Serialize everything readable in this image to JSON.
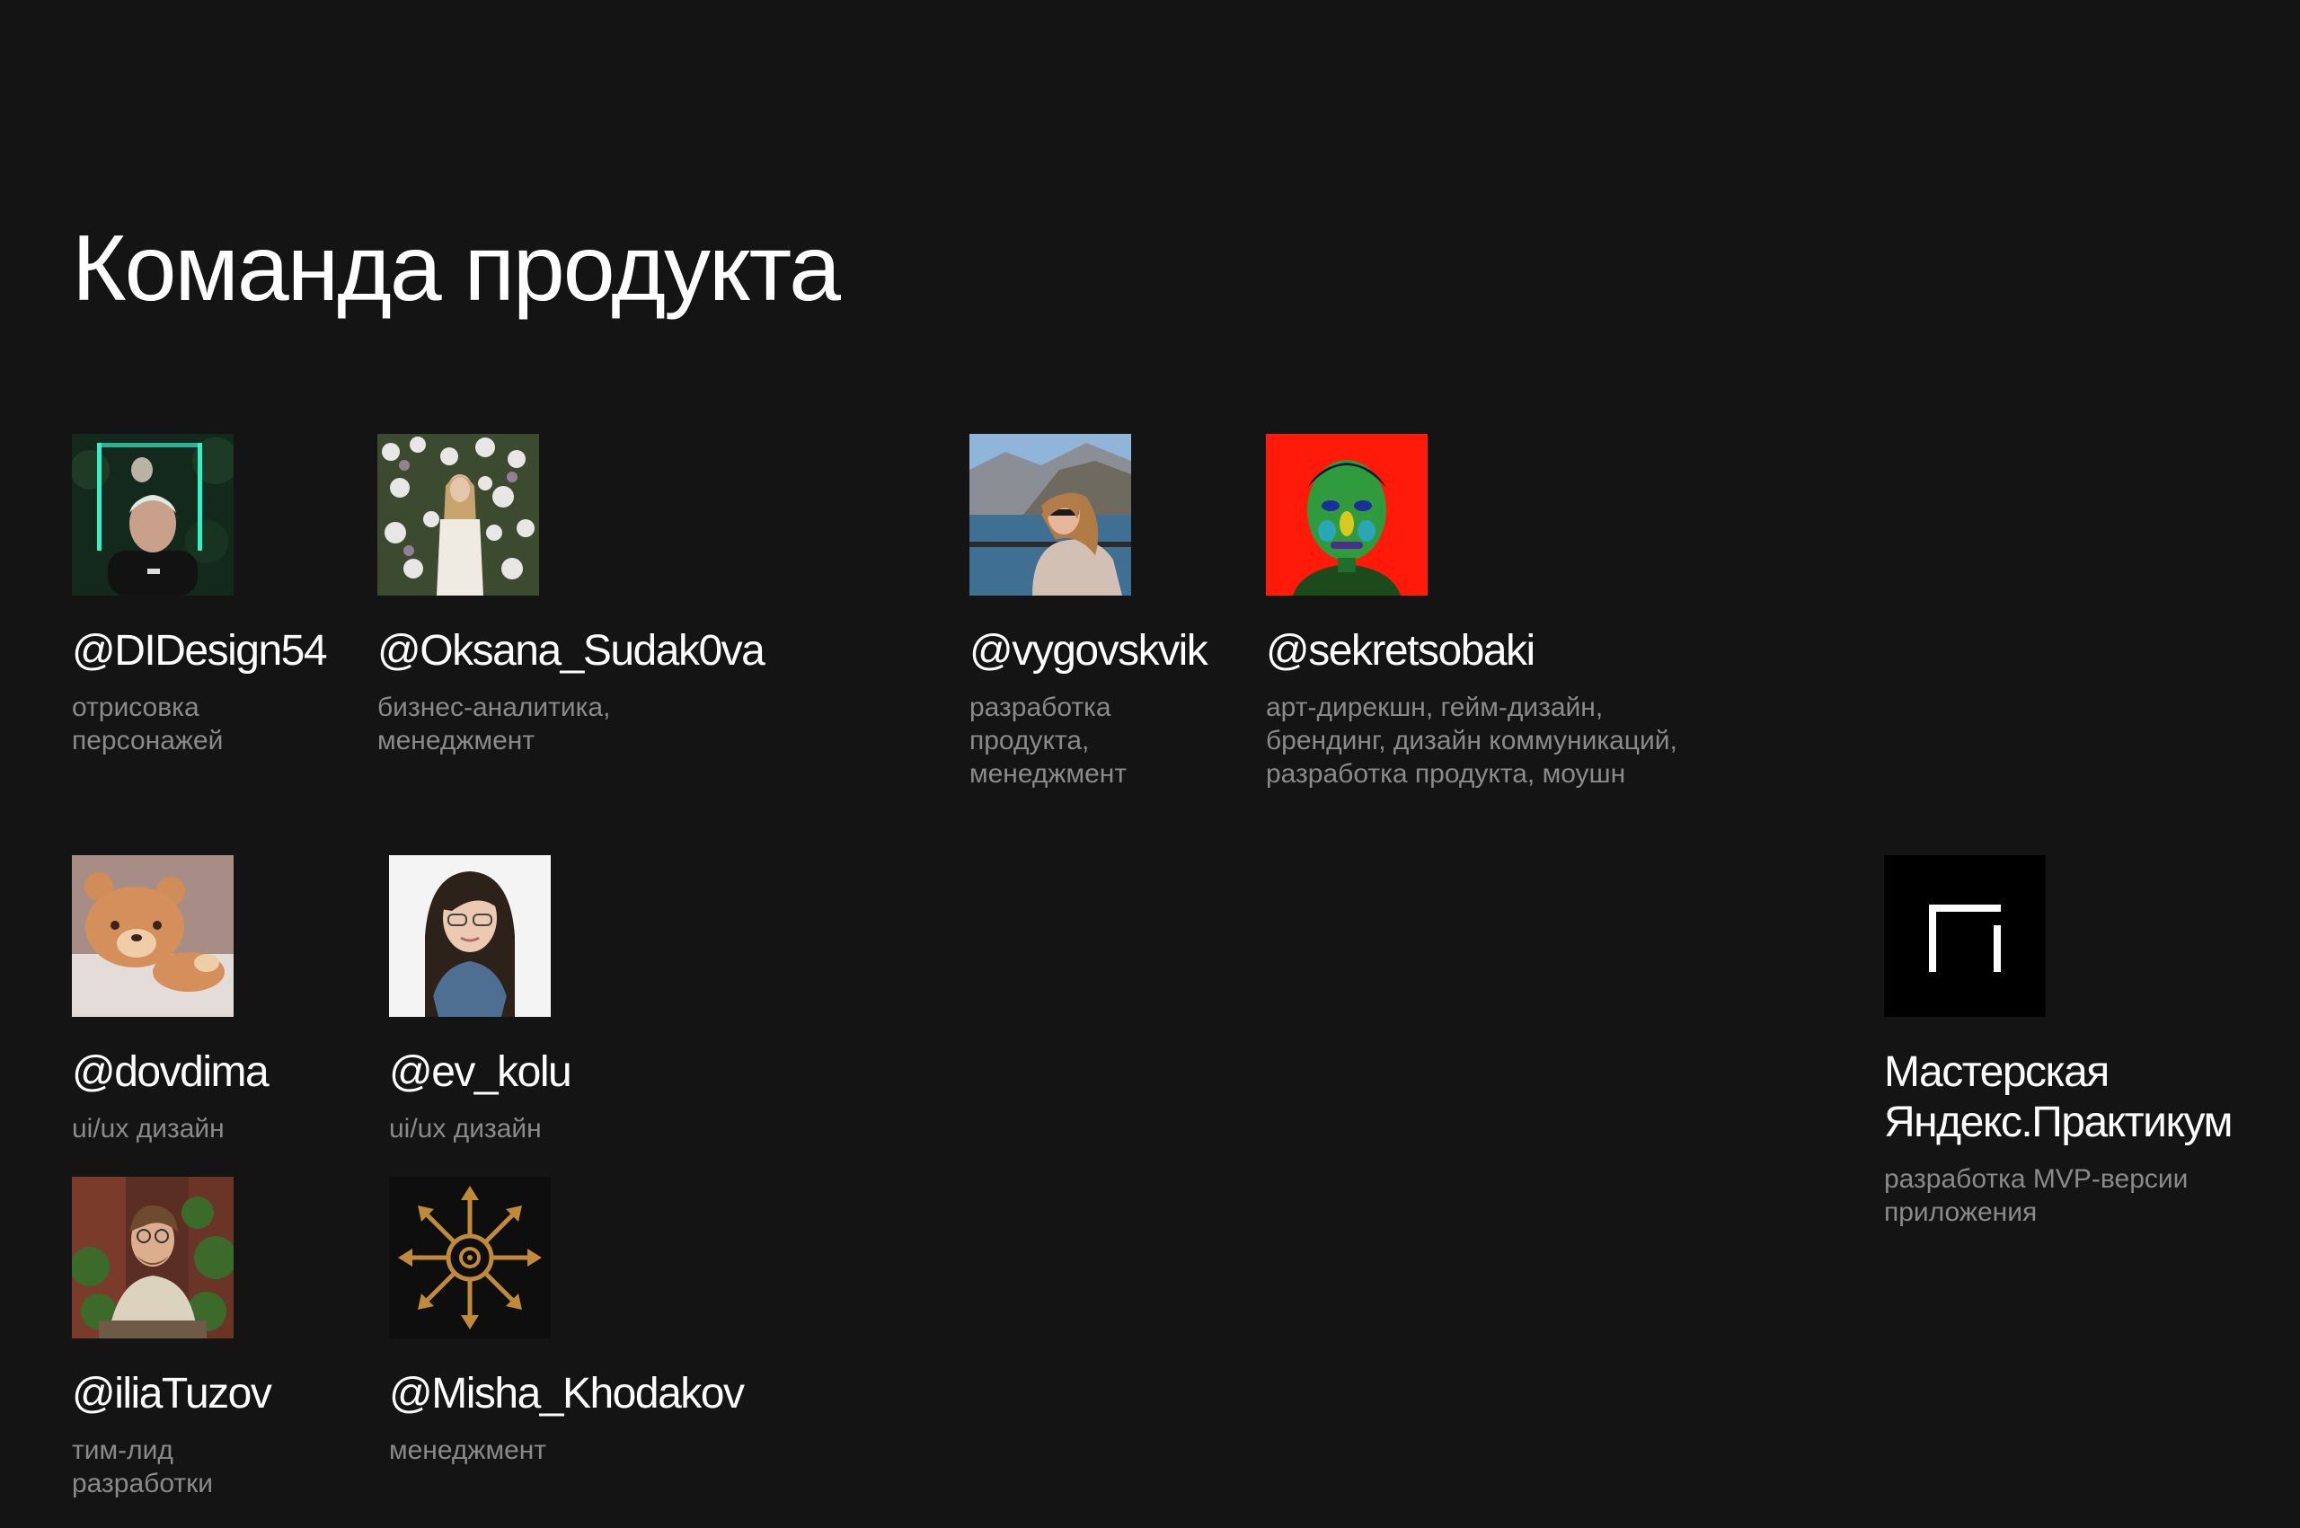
{
  "page": {
    "title": "Команда продукта"
  },
  "members": [
    {
      "handle": "@DIDesign54",
      "role": "отрисовка\nперсонажей",
      "avatar": "photo-neon-portrait"
    },
    {
      "handle": "@Oksana_Sudak0va",
      "role": "бизнес-аналитика,\nменеджмент",
      "avatar": "photo-flowers-portrait"
    },
    {
      "handle": "@vygovskvik",
      "role": "разработка\nпродукта,\nменеджмент",
      "avatar": "photo-lake-portrait"
    },
    {
      "handle": "@sekretsobaki",
      "role": "арт-дирекшн, гейм-дизайн,\nбрендинг, дизайн коммуникаций,\nразработка продукта, моушн",
      "avatar": "photo-thermal-portrait"
    },
    {
      "handle": "@dovdima",
      "role": "ui/ux дизайн",
      "avatar": "photo-teddy-bear"
    },
    {
      "handle": "@ev_kolu",
      "role": "ui/ux дизайн",
      "avatar": "photo-studio-portrait"
    },
    {
      "handle": "@iliaTuzov",
      "role": "тим-лид\nразработки",
      "avatar": "photo-garden-portrait"
    },
    {
      "handle": "@Misha_Khodakov",
      "role": "менеджмент",
      "avatar": "chaos-star-icon"
    }
  ],
  "studio": {
    "name": "Мастерская\nЯндекс.Практикум",
    "role": "разработка MVP-версии\nприложения",
    "logo": "practicum-logo-icon"
  },
  "colors": {
    "background": "#141414",
    "text_primary": "#ffffff",
    "text_secondary": "#8a8a8a"
  }
}
